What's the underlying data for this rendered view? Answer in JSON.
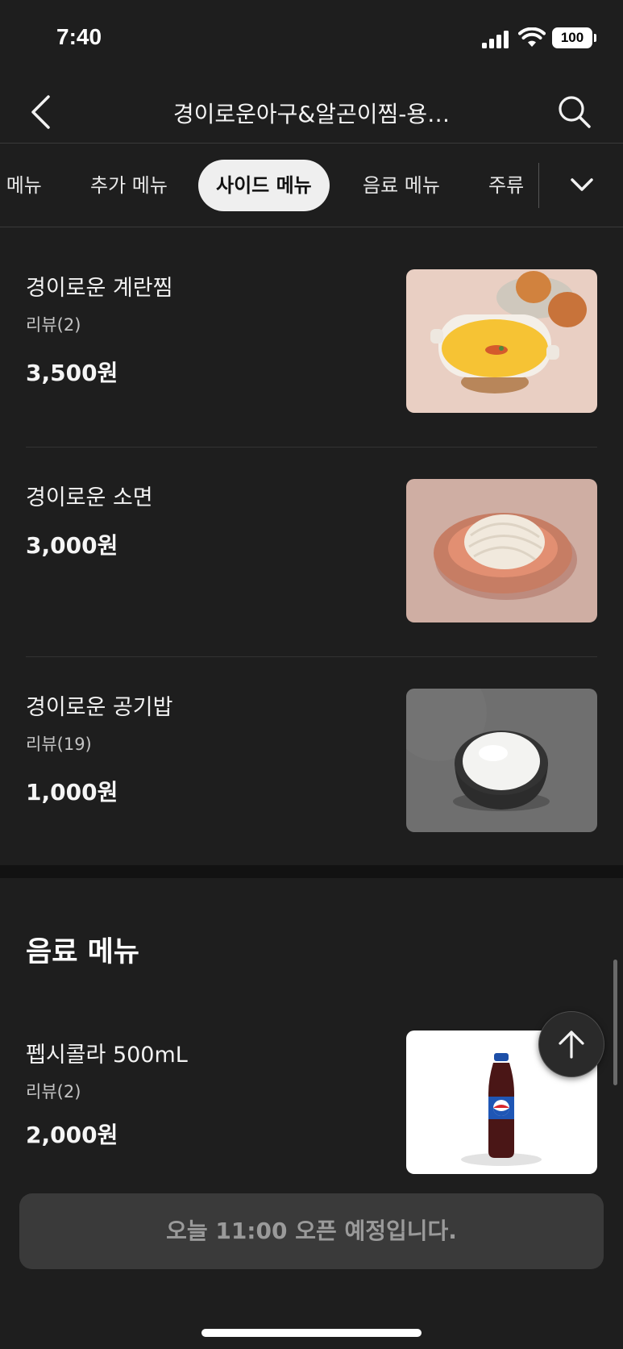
{
  "status_bar": {
    "time": "7:40",
    "battery": "100"
  },
  "header": {
    "title": "경이로운아구&알곤이찜-용…"
  },
  "tabs": [
    {
      "label": "구 메뉴"
    },
    {
      "label": "추가 메뉴"
    },
    {
      "label": "사이드 메뉴"
    },
    {
      "label": "음료 메뉴"
    },
    {
      "label": "주류"
    }
  ],
  "side_menu_items": [
    {
      "name": "경이로운 계란찜",
      "review": "리뷰(2)",
      "price": "3,500원",
      "image": "steamed-egg"
    },
    {
      "name": "경이로운 소면",
      "review": "",
      "price": "3,000원",
      "image": "noodles"
    },
    {
      "name": "경이로운 공기밥",
      "review": "리뷰(19)",
      "price": "1,000원",
      "image": "rice-bowl"
    }
  ],
  "drink_section": {
    "title": "음료 메뉴",
    "items": [
      {
        "name": "펩시콜라 500mL",
        "review": "리뷰(2)",
        "price": "2,000원",
        "image": "pepsi-bottle"
      }
    ]
  },
  "open_notice": "오늘 11:00 오픈 예정입니다.",
  "colors": {
    "background": "#1e1e1e",
    "active_tab": "#efefef",
    "banner": "#3a3a3a"
  }
}
